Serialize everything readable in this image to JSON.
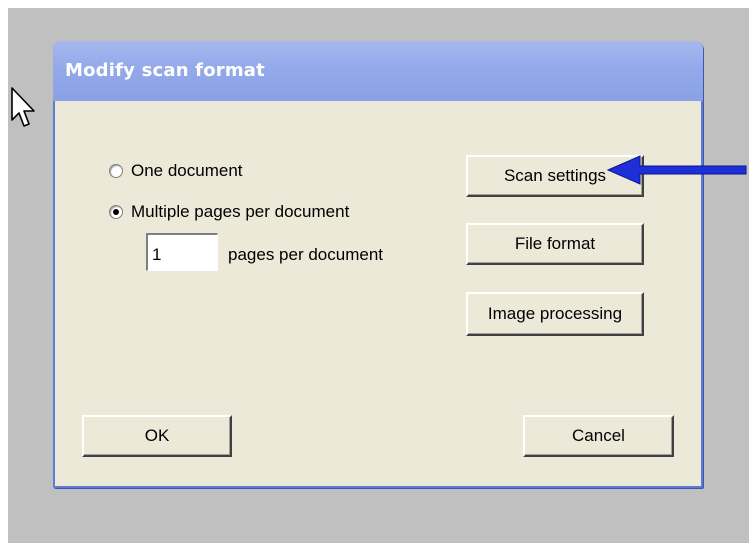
{
  "dialog": {
    "title": "Modify scan format",
    "options": [
      {
        "label": "One document",
        "selected": false
      },
      {
        "label": "Multiple pages per document",
        "selected": true
      }
    ],
    "pages_value": "1",
    "pages_label": "pages per document",
    "buttons": {
      "scan_settings": "Scan settings",
      "file_format": "File format",
      "image_processing": "Image processing",
      "ok": "OK",
      "cancel": "Cancel"
    }
  },
  "icons": {
    "cursor": "mouse-pointer-icon",
    "pointer_arrow": "arrow-left-icon"
  },
  "colors": {
    "titlebar": "#93a9ea",
    "dialog_bg": "#ece9d8",
    "annotation_arrow": "#1f2fd8"
  }
}
